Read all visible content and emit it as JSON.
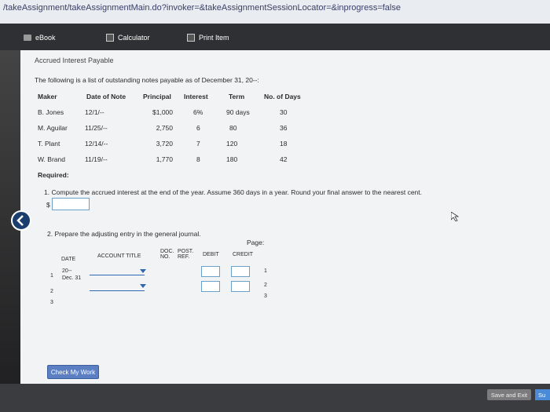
{
  "url": "/takeAssignment/takeAssignmentMain.do?invoker=&takeAssignmentSessionLocator=&inprogress=false",
  "toolbar": {
    "ebook": "eBook",
    "calculator": "Calculator",
    "print": "Print Item"
  },
  "problem": {
    "title": "Accrued Interest Payable",
    "intro": "The following is a list of outstanding notes payable as of December 31, 20--:",
    "headers": [
      "Maker",
      "Date of Note",
      "Principal",
      "Interest",
      "Term",
      "No. of Days"
    ],
    "rows": [
      [
        "B. Jones",
        "12/1/--",
        "$1,000",
        "6%",
        "90 days",
        "30"
      ],
      [
        "M. Aguilar",
        "11/25/--",
        "2,750",
        "6",
        "80",
        "36"
      ],
      [
        "T. Plant",
        "12/14/--",
        "3,720",
        "7",
        "120",
        "18"
      ],
      [
        "W. Brand",
        "11/19/--",
        "1,770",
        "8",
        "180",
        "42"
      ]
    ],
    "required": "Required:",
    "q1": "1.  Compute the accrued interest at the end of the year. Assume 360 days in a year. Round your final answer to the nearest cent.",
    "q1_prefix": "$",
    "q2": "2.  Prepare the adjusting entry in the general journal."
  },
  "journal": {
    "page_label": "Page:",
    "date": "DATE",
    "account_title": "ACCOUNT TITLE",
    "doc_no": "DOC.\nNO.",
    "post_ref": "POST.\nREF.",
    "debit": "DEBIT",
    "credit": "CREDIT",
    "year": "20--",
    "date_val": "Dec. 31",
    "line_nums": [
      "1",
      "2",
      "3"
    ],
    "right_nums": [
      "1",
      "2",
      "3"
    ]
  },
  "buttons": {
    "check": "Check My Work",
    "save": "Save and Exit",
    "submit": "Su"
  }
}
